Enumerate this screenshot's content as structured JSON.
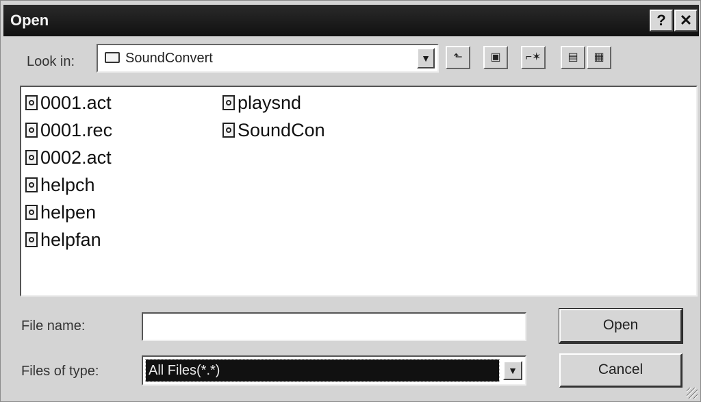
{
  "window": {
    "title": "Open",
    "help_glyph": "?",
    "close_glyph": "✕"
  },
  "lookin": {
    "label": "Look in:",
    "value": "SoundConvert",
    "icon": "folder-icon"
  },
  "toolbar": {
    "up_folder_icon": "up-one-level-icon",
    "desktop_icon": "desktop-icon",
    "new_folder_icon": "create-new-folder-icon",
    "list_view_icon": "list-view-icon",
    "details_view_icon": "details-view-icon"
  },
  "files": [
    "0001.act",
    "0001.rec",
    "0002.act",
    "helpch",
    "helpen",
    "helpfan",
    "playsnd",
    "SoundCon"
  ],
  "filename": {
    "label": "File name:",
    "value": ""
  },
  "filetype": {
    "label": "Files of type:",
    "value": "All Files(*.*)"
  },
  "buttons": {
    "open": "Open",
    "cancel": "Cancel"
  }
}
